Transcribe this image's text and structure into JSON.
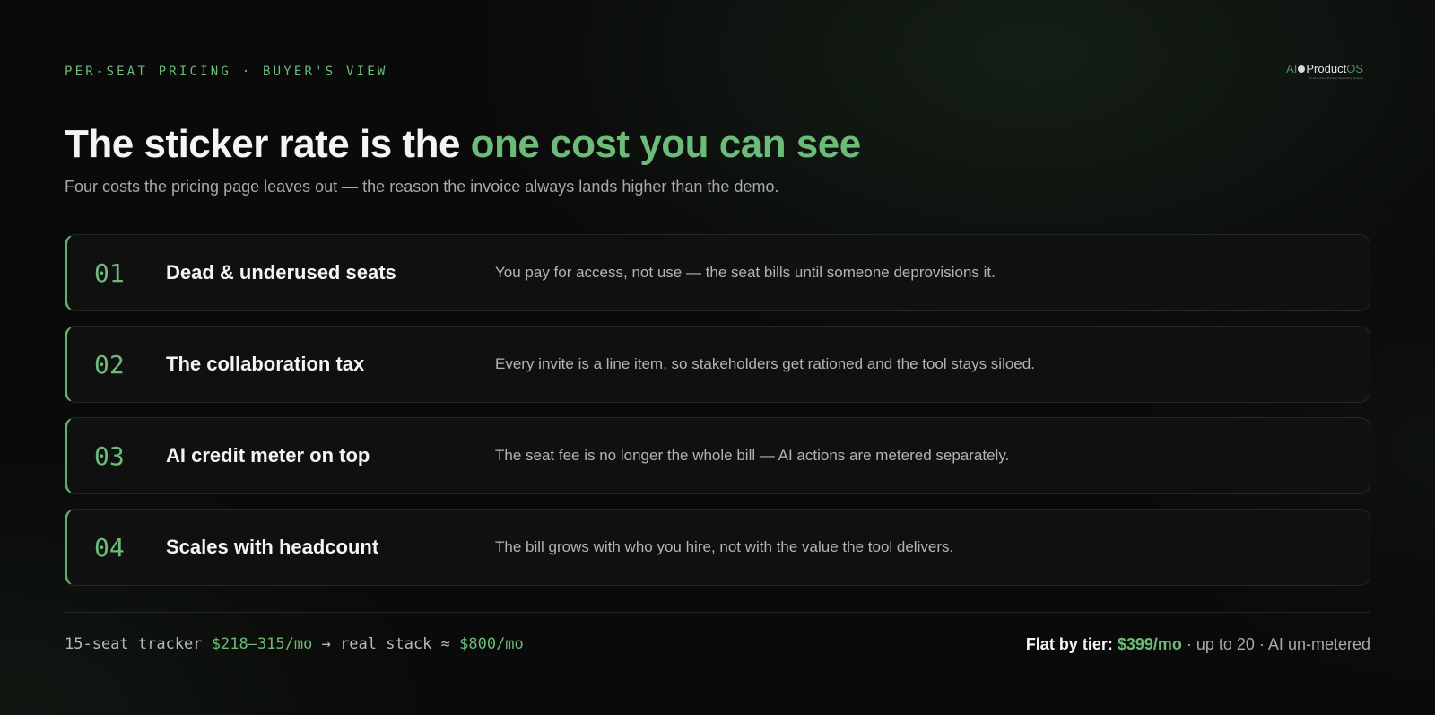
{
  "eyebrow": "PER-SEAT PRICING · BUYER'S VIEW",
  "logo": {
    "ai": "AI",
    "product": "Product",
    "os": "OS",
    "tagline": "AI Optimized Product Operating System"
  },
  "headline": {
    "lead": "The sticker rate is the ",
    "accent": "one cost you can see"
  },
  "subtitle": "Four costs the pricing page leaves out — the reason the invoice always lands higher than the demo.",
  "costs": [
    {
      "num": "01",
      "title": "Dead & underused seats",
      "desc": "You pay for access, not use — the seat bills until someone deprovisions it."
    },
    {
      "num": "02",
      "title": "The collaboration tax",
      "desc": "Every invite is a line item, so stakeholders get rationed and the tool stays siloed."
    },
    {
      "num": "03",
      "title": "AI credit meter on top",
      "desc": "The seat fee is no longer the whole bill — AI actions are metered separately."
    },
    {
      "num": "04",
      "title": "Scales with headcount",
      "desc": "The bill grows with who you hire, not with the value the tool delivers."
    }
  ],
  "footer": {
    "left_prefix": "15-seat tracker ",
    "left_range": "$218–315/mo",
    "left_mid": " → real stack ≈ ",
    "left_total": "$800/mo",
    "right_label": "Flat by tier: ",
    "right_price": "$399/mo",
    "right_rest": " · up to 20 · AI un-metered"
  },
  "colors": {
    "accent": "#6dbb78",
    "background": "#0a0a0a",
    "border": "#262626"
  }
}
